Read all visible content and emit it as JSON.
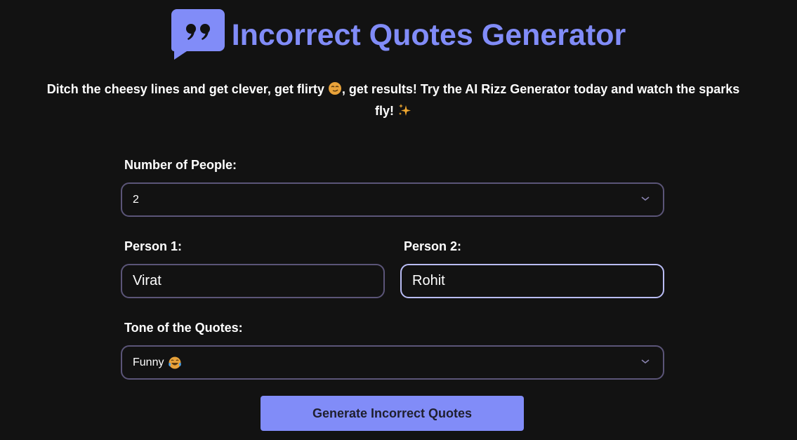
{
  "header": {
    "logo_icon": "quote-bubble-icon",
    "title": "Incorrect Quotes Generator"
  },
  "tagline": {
    "part1": "Ditch the cheesy lines and get clever, get flirty ",
    "emoji1": "smirking-face-emoji",
    "part2": ", get results! Try the AI Rizz Generator today and watch the sparks fly! ",
    "emoji2": "sparkles-emoji"
  },
  "form": {
    "people_count": {
      "label": "Number of People:",
      "selected": "2"
    },
    "person1": {
      "label": "Person 1:",
      "value": "Virat"
    },
    "person2": {
      "label": "Person 2:",
      "value": "Rohit"
    },
    "tone": {
      "label": "Tone of the Quotes:",
      "selected": "Funny",
      "emoji": "tears-of-joy-emoji"
    },
    "generate_label": "Generate Incorrect Quotes"
  },
  "colors": {
    "background": "#121212",
    "accent": "#818cf8",
    "border": "#5b5578",
    "focus_border": "#b9bcf5"
  }
}
